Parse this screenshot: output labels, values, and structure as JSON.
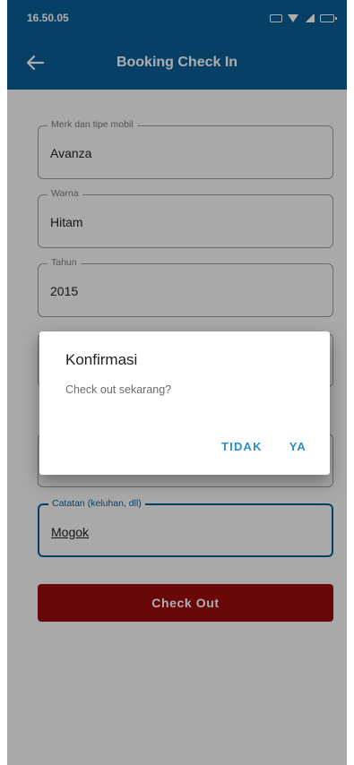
{
  "status_bar": {
    "time": "16.50.05",
    "icons": [
      "sim-icon",
      "wifi-icon",
      "signal-icon",
      "battery-icon"
    ]
  },
  "app_bar": {
    "title": "Booking Check In",
    "back_icon": "arrow-left-icon",
    "color": "#0b5f98"
  },
  "form": {
    "fields": [
      {
        "label": "Merk dan tipe mobil",
        "value": "Avanza"
      },
      {
        "label": "Warna",
        "value": "Hitam"
      },
      {
        "label": "Tahun",
        "value": "2015"
      },
      {
        "label": "",
        "value": ""
      },
      {
        "label": "",
        "value": ""
      },
      {
        "label": "Catatan (keluhan, dll)",
        "value": "Mogok"
      }
    ]
  },
  "checkout_button": {
    "label": "Check Out",
    "color": "#9b0d0d"
  },
  "dialog": {
    "title": "Konfirmasi",
    "message": "Check out sekarang?",
    "cancel_label": "TIDAK",
    "confirm_label": "YA",
    "action_color": "#2a8fc6"
  }
}
